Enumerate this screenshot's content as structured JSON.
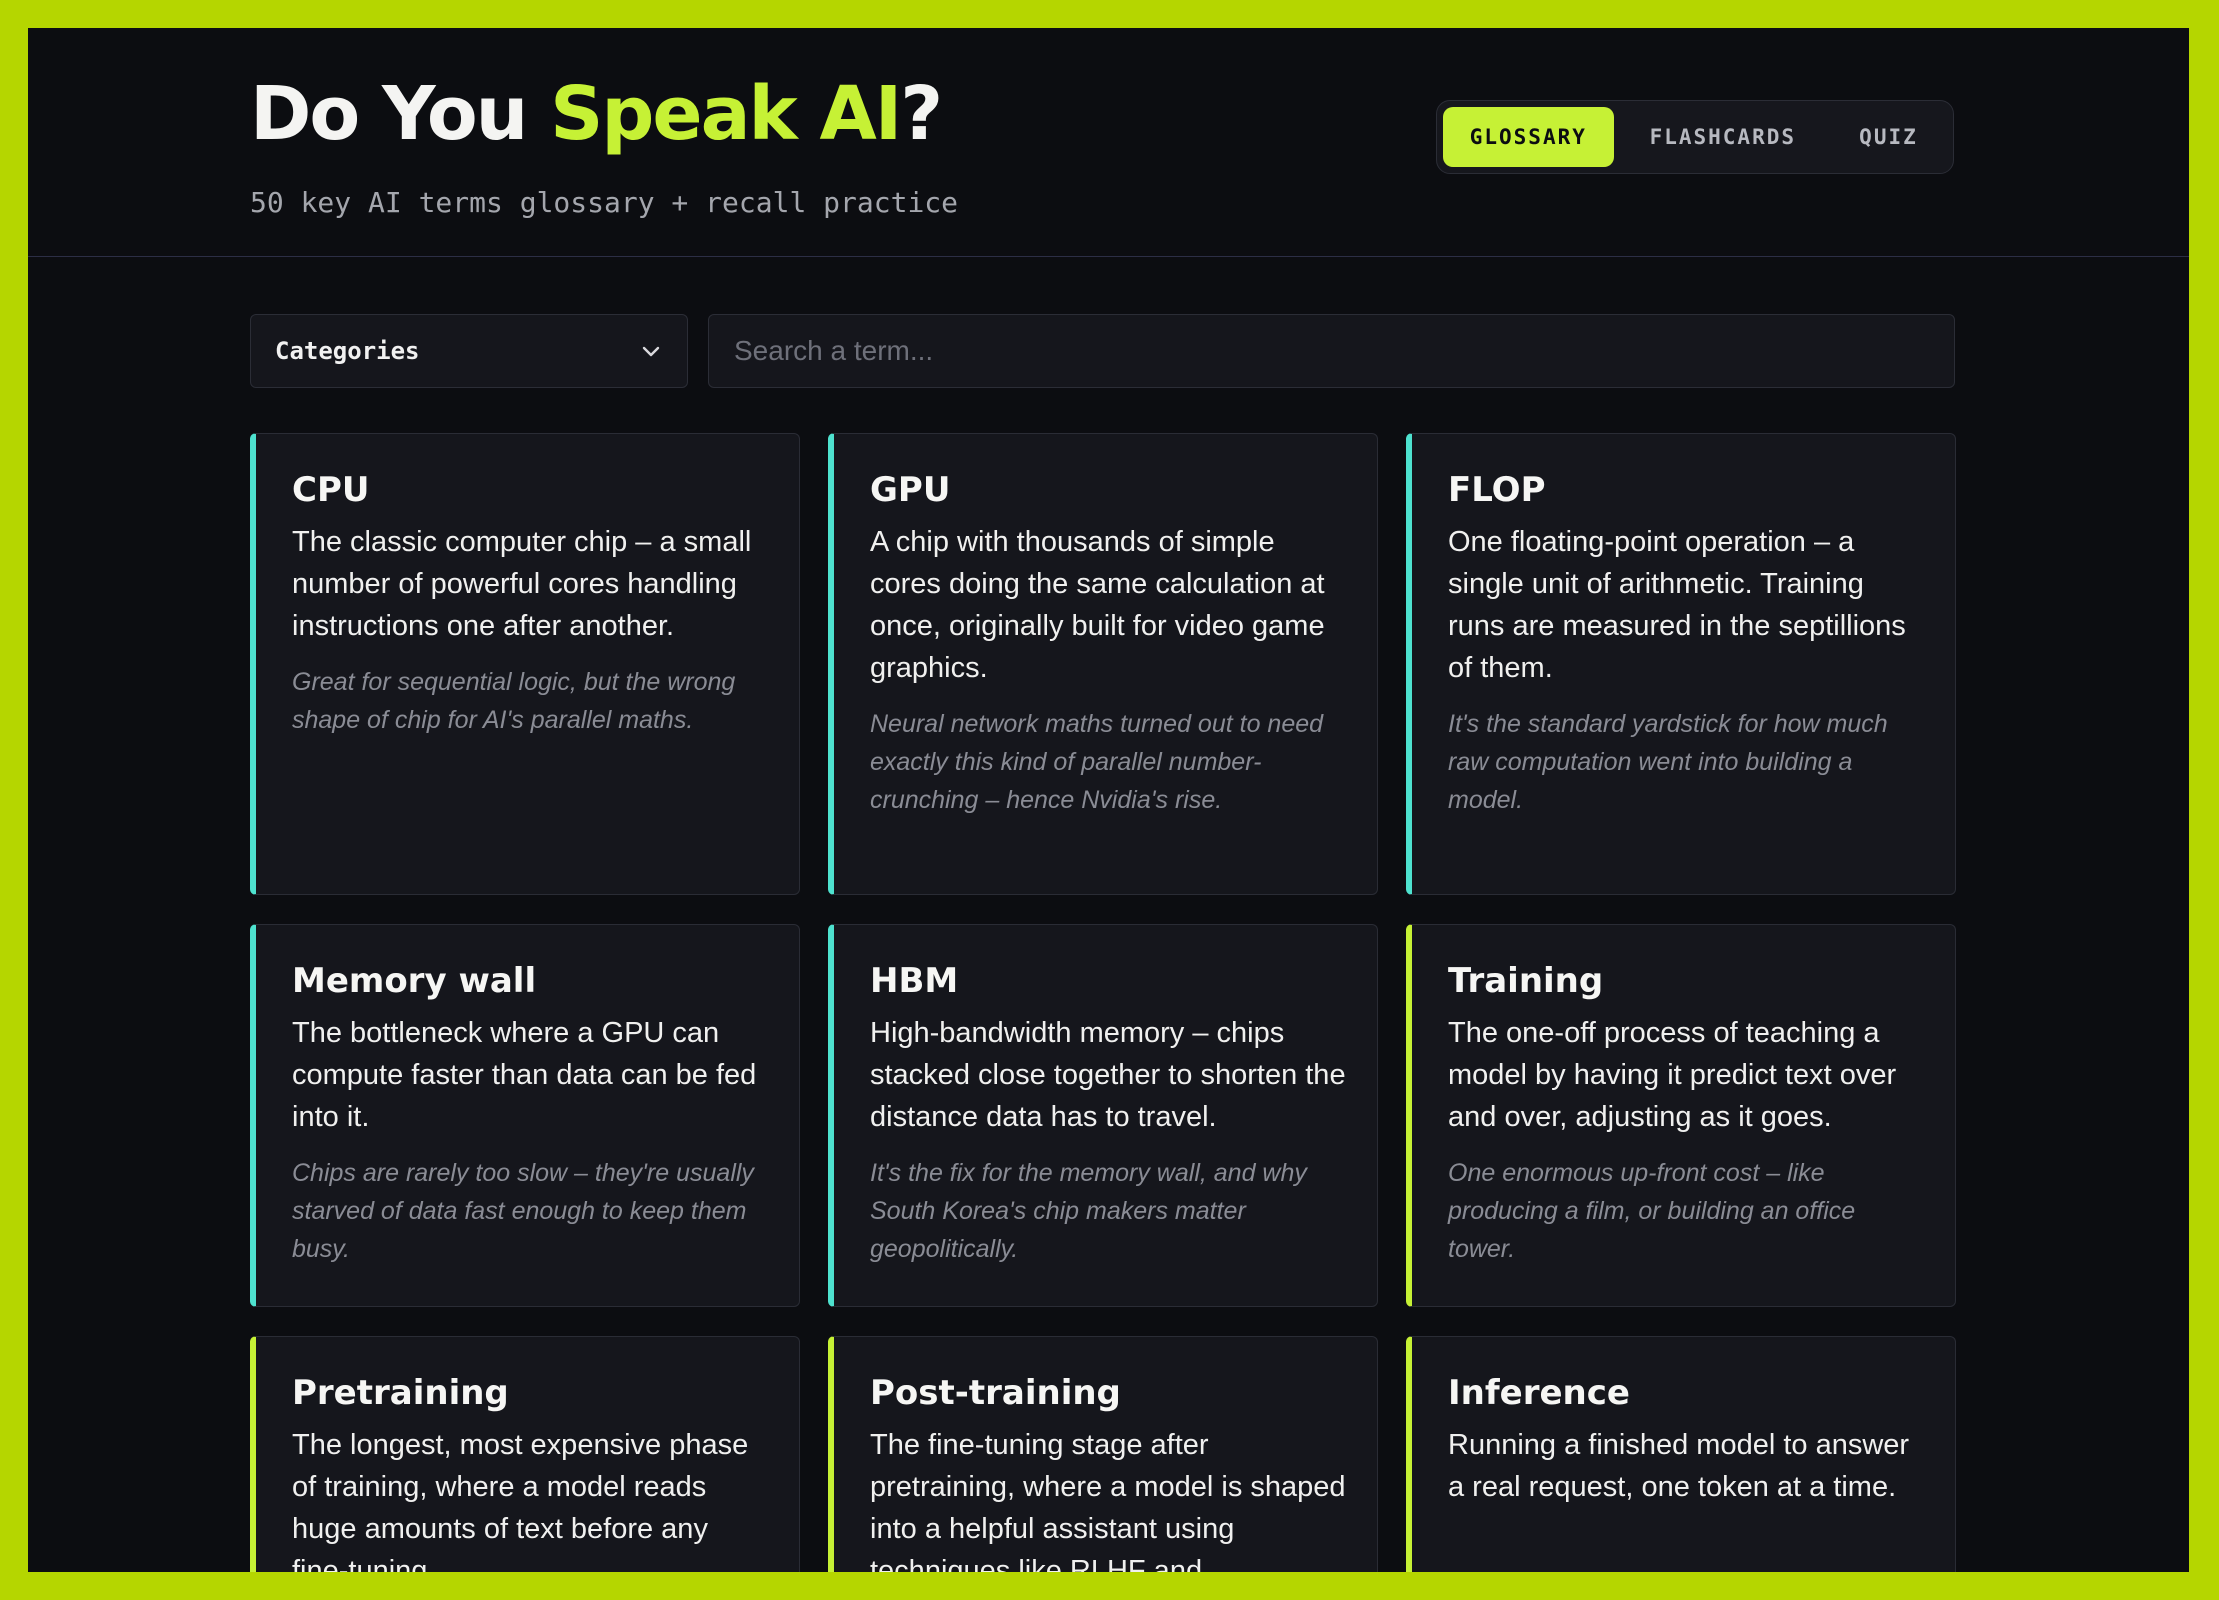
{
  "header": {
    "title_part1": "Do You ",
    "title_accent": "Speak AI",
    "title_part2": "?",
    "subtitle": "50 key AI terms glossary + recall practice"
  },
  "tabs": [
    {
      "label": "GLOSSARY",
      "active": true
    },
    {
      "label": "FLASHCARDS",
      "active": false
    },
    {
      "label": "QUIZ",
      "active": false
    }
  ],
  "filters": {
    "category_label": "Categories",
    "search_placeholder": "Search a term..."
  },
  "colors": {
    "accent_lime": "#c6f135",
    "accent_teal": "#4ee2cf",
    "background": "#0c0d11",
    "frame": "#b5d600"
  },
  "cards": [
    {
      "term": "CPU",
      "definition": "The classic computer chip – a small number of powerful cores handling instructions one after another.",
      "note": "Great for sequential logic, but the wrong shape of chip for AI's parallel maths.",
      "accent": "teal"
    },
    {
      "term": "GPU",
      "definition": "A chip with thousands of simple cores doing the same calculation at once, originally built for video game graphics.",
      "note": "Neural network maths turned out to need exactly this kind of parallel number-crunching – hence Nvidia's rise.",
      "accent": "teal"
    },
    {
      "term": "FLOP",
      "definition": "One floating-point operation – a single unit of arithmetic. Training runs are measured in the septillions of them.",
      "note": "It's the standard yardstick for how much raw computation went into building a model.",
      "accent": "teal"
    },
    {
      "term": "Memory wall",
      "definition": "The bottleneck where a GPU can compute faster than data can be fed into it.",
      "note": "Chips are rarely too slow – they're usually starved of data fast enough to keep them busy.",
      "accent": "teal"
    },
    {
      "term": "HBM",
      "definition": "High-bandwidth memory – chips stacked close together to shorten the distance data has to travel.",
      "note": "It's the fix for the memory wall, and why South Korea's chip makers matter geopolitically.",
      "accent": "teal"
    },
    {
      "term": "Training",
      "definition": "The one-off process of teaching a model by having it predict text over and over, adjusting as it goes.",
      "note": "One enormous up-front cost – like producing a film, or building an office tower.",
      "accent": "lime"
    },
    {
      "term": "Pretraining",
      "definition": "The longest, most expensive phase of training, where a model reads huge amounts of text before any fine-tuning.",
      "note": "",
      "accent": "lime"
    },
    {
      "term": "Post-training",
      "definition": "The fine-tuning stage after pretraining, where a model is shaped into a helpful assistant using techniques like RLHF and",
      "note": "",
      "accent": "lime"
    },
    {
      "term": "Inference",
      "definition": "Running a finished model to answer a real request, one token at a time.",
      "note": "",
      "accent": "lime"
    }
  ]
}
